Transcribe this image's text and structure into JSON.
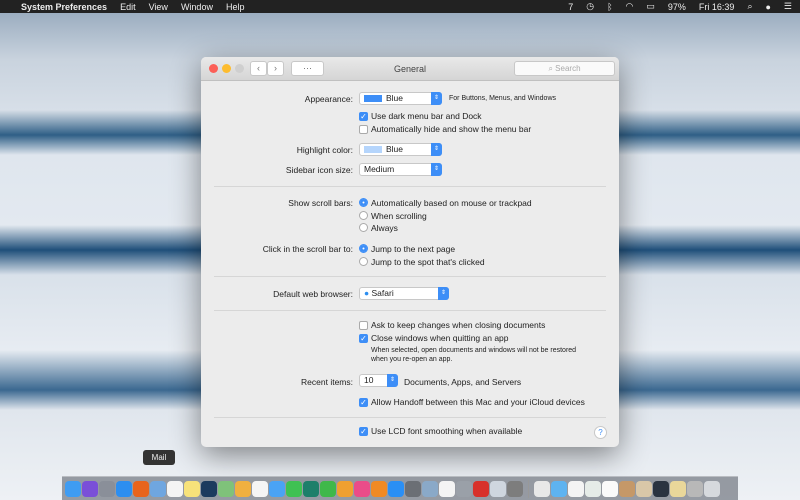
{
  "menubar": {
    "app": "System Preferences",
    "items": [
      "Edit",
      "View",
      "Window",
      "Help"
    ],
    "notification_count": "7",
    "battery": "97%",
    "clock": "Fri 16:39"
  },
  "window": {
    "title": "General",
    "search_placeholder": "Search",
    "back": "‹",
    "forward": "›",
    "grid": "⋯"
  },
  "appearance": {
    "label": "Appearance:",
    "value": "Blue",
    "swatch": "#3d8ef7",
    "note": "For Buttons, Menus, and Windows"
  },
  "dark_menu": {
    "label": "Use dark menu bar and Dock",
    "checked": true
  },
  "auto_hide": {
    "label": "Automatically hide and show the menu bar",
    "checked": false
  },
  "highlight": {
    "label": "Highlight color:",
    "value": "Blue",
    "swatch": "#b5d5fc"
  },
  "sidebar_size": {
    "label": "Sidebar icon size:",
    "value": "Medium"
  },
  "scroll_bars": {
    "label": "Show scroll bars:",
    "options": [
      "Automatically based on mouse or trackpad",
      "When scrolling",
      "Always"
    ],
    "selected": 0
  },
  "click_scroll": {
    "label": "Click in the scroll bar to:",
    "options": [
      "Jump to the next page",
      "Jump to the spot that's clicked"
    ],
    "selected": 0
  },
  "browser": {
    "label": "Default web browser:",
    "value": "Safari"
  },
  "ask_keep": {
    "label": "Ask to keep changes when closing documents",
    "checked": false
  },
  "close_windows": {
    "label": "Close windows when quitting an app",
    "checked": true
  },
  "close_note": [
    "When selected, open documents and windows will not be restored",
    "when you re-open an app."
  ],
  "recent": {
    "label": "Recent items:",
    "value": "10",
    "suffix": "Documents, Apps, and Servers"
  },
  "handoff": {
    "label": "Allow Handoff between this Mac and your iCloud devices",
    "checked": true
  },
  "lcd": {
    "label": "Use LCD font smoothing when available",
    "checked": true
  },
  "help": "?",
  "dock": {
    "tooltip": "Mail",
    "apps": [
      {
        "name": "finder",
        "color": "#3f9cf2"
      },
      {
        "name": "siri",
        "color": "#7a4fd8"
      },
      {
        "name": "launchpad",
        "color": "#8a8f99"
      },
      {
        "name": "safari",
        "color": "#2c8ef0"
      },
      {
        "name": "firefox",
        "color": "#e8641c"
      },
      {
        "name": "mail",
        "color": "#6fa6e0"
      },
      {
        "name": "calendar",
        "color": "#f4f4f4"
      },
      {
        "name": "notes",
        "color": "#f7e27a"
      },
      {
        "name": "photoshop",
        "color": "#1c3a5e"
      },
      {
        "name": "maps",
        "color": "#7fc27a"
      },
      {
        "name": "photos",
        "color": "#f0b040"
      },
      {
        "name": "reminders",
        "color": "#f5f5f5"
      },
      {
        "name": "messages",
        "color": "#4aa3f5"
      },
      {
        "name": "facetime",
        "color": "#3fc153"
      },
      {
        "name": "time-machine",
        "color": "#1d7f6a"
      },
      {
        "name": "numbers",
        "color": "#3fb84a"
      },
      {
        "name": "pages",
        "color": "#f0a030"
      },
      {
        "name": "itunes",
        "color": "#ea4c89"
      },
      {
        "name": "ibooks",
        "color": "#f08a24"
      },
      {
        "name": "app-store",
        "color": "#2a8ff5"
      },
      {
        "name": "system-preferences",
        "color": "#6b6f75"
      },
      {
        "name": "preview",
        "color": "#8aa9c8"
      },
      {
        "name": "slack",
        "color": "#f4f4f4"
      },
      {
        "name": "script-editor",
        "color": "#9aa0a8"
      },
      {
        "name": "pdf-app",
        "color": "#d8312a"
      },
      {
        "name": "network-utility",
        "color": "#cfd6df"
      },
      {
        "name": "automator",
        "color": "#7d7d7d"
      }
    ],
    "stacks": [
      {
        "name": "documents",
        "color": "#e8e8e8"
      },
      {
        "name": "folder",
        "color": "#5eb3f0"
      },
      {
        "name": "doc1",
        "color": "#f4f4f4"
      },
      {
        "name": "doc2",
        "color": "#e6ece8"
      },
      {
        "name": "doc3",
        "color": "#fafafa"
      },
      {
        "name": "image1",
        "color": "#c59868"
      },
      {
        "name": "image2",
        "color": "#d9c7a8"
      },
      {
        "name": "image3",
        "color": "#2a3340"
      },
      {
        "name": "image4",
        "color": "#e9d79a"
      },
      {
        "name": "image5",
        "color": "#b8b8b8"
      },
      {
        "name": "trash",
        "color": "#d6d9dd"
      }
    ]
  }
}
